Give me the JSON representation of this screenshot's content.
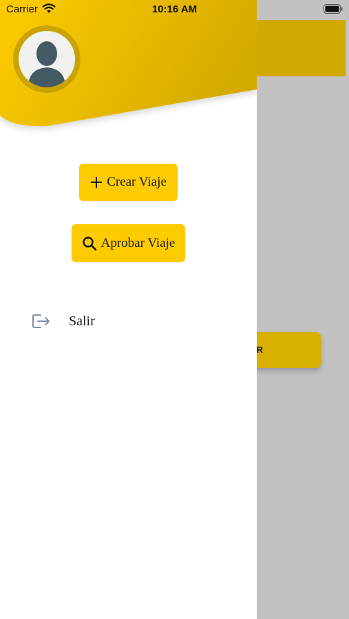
{
  "status_bar": {
    "carrier": "Carrier",
    "time": "10:16 AM"
  },
  "background": {
    "button_text_fragment": "R"
  },
  "drawer": {
    "buttons": [
      {
        "label": "Crear Viaje",
        "icon": "plus-icon"
      },
      {
        "label": "Aprobar Viaje",
        "icon": "search-icon"
      }
    ],
    "logout": {
      "label": "Salir",
      "icon": "logout-icon"
    }
  },
  "colors": {
    "accent": "#fdcb00",
    "accent_dark": "#d2a900",
    "overlay": "#c2c2c2",
    "icon_blue": "#6f83a0"
  }
}
